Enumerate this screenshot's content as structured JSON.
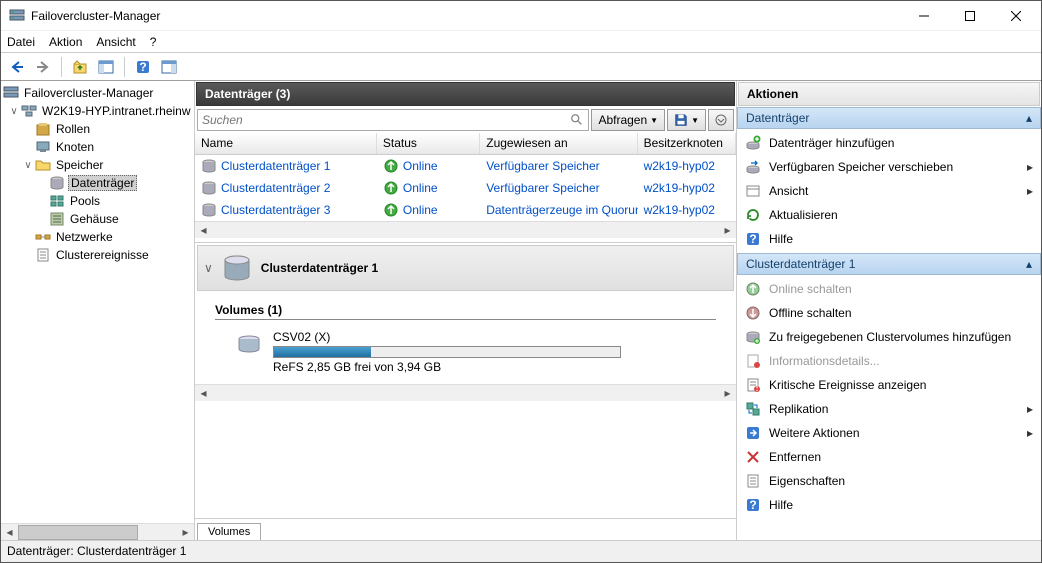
{
  "window": {
    "title": "Failovercluster-Manager"
  },
  "menu": {
    "file": "Datei",
    "action": "Aktion",
    "view": "Ansicht",
    "help": "?"
  },
  "tree": {
    "root": "Failovercluster-Manager",
    "cluster": "W2K19-HYP.intranet.rheinw",
    "roles": "Rollen",
    "nodes": "Knoten",
    "storage": "Speicher",
    "disks": "Datenträger",
    "pools": "Pools",
    "enclosures": "Gehäuse",
    "networks": "Netzwerke",
    "events": "Clusterereignisse"
  },
  "header": {
    "title": "Datenträger (3)"
  },
  "search": {
    "placeholder": "Suchen",
    "query_btn": "Abfragen"
  },
  "columns": {
    "name": "Name",
    "status": "Status",
    "assigned": "Zugewiesen an",
    "owner": "Besitzerknoten"
  },
  "rows": [
    {
      "name": "Clusterdatenträger 1",
      "status": "Online",
      "assigned": "Verfügbarer Speicher",
      "owner": "w2k19-hyp02"
    },
    {
      "name": "Clusterdatenträger 2",
      "status": "Online",
      "assigned": "Verfügbarer Speicher",
      "owner": "w2k19-hyp02"
    },
    {
      "name": "Clusterdatenträger 3",
      "status": "Online",
      "assigned": "Datenträgerzeuge im Quorum",
      "owner": "w2k19-hyp02"
    }
  ],
  "detail": {
    "title": "Clusterdatenträger 1",
    "volumes_label": "Volumes (1)",
    "vol_name": "CSV02 (X)",
    "vol_info": "ReFS 2,85 GB frei von 3,94 GB",
    "fill_pct": 28,
    "tab": "Volumes"
  },
  "actions": {
    "pane_title": "Aktionen",
    "sec1": "Datenträger",
    "items1": [
      {
        "label": "Datenträger hinzufügen",
        "icon": "add-disk",
        "sub": false
      },
      {
        "label": "Verfügbaren Speicher verschieben",
        "icon": "move",
        "sub": true
      },
      {
        "label": "Ansicht",
        "icon": "view",
        "sub": true
      },
      {
        "label": "Aktualisieren",
        "icon": "refresh",
        "sub": false
      },
      {
        "label": "Hilfe",
        "icon": "help",
        "sub": false
      }
    ],
    "sec2": "Clusterdatenträger 1",
    "items2": [
      {
        "label": "Online schalten",
        "icon": "online",
        "sub": false,
        "disabled": true
      },
      {
        "label": "Offline schalten",
        "icon": "offline",
        "sub": false
      },
      {
        "label": "Zu freigegebenen Clustervolumes hinzufügen",
        "icon": "csv",
        "sub": false
      },
      {
        "label": "Informationsdetails...",
        "icon": "info",
        "sub": false,
        "disabled": true
      },
      {
        "label": "Kritische Ereignisse anzeigen",
        "icon": "events",
        "sub": false
      },
      {
        "label": "Replikation",
        "icon": "replication",
        "sub": true
      },
      {
        "label": "Weitere Aktionen",
        "icon": "more",
        "sub": true
      },
      {
        "label": "Entfernen",
        "icon": "remove",
        "sub": false
      },
      {
        "label": "Eigenschaften",
        "icon": "props",
        "sub": false
      },
      {
        "label": "Hilfe",
        "icon": "help",
        "sub": false
      }
    ]
  },
  "statusbar": "Datenträger:  Clusterdatenträger 1"
}
